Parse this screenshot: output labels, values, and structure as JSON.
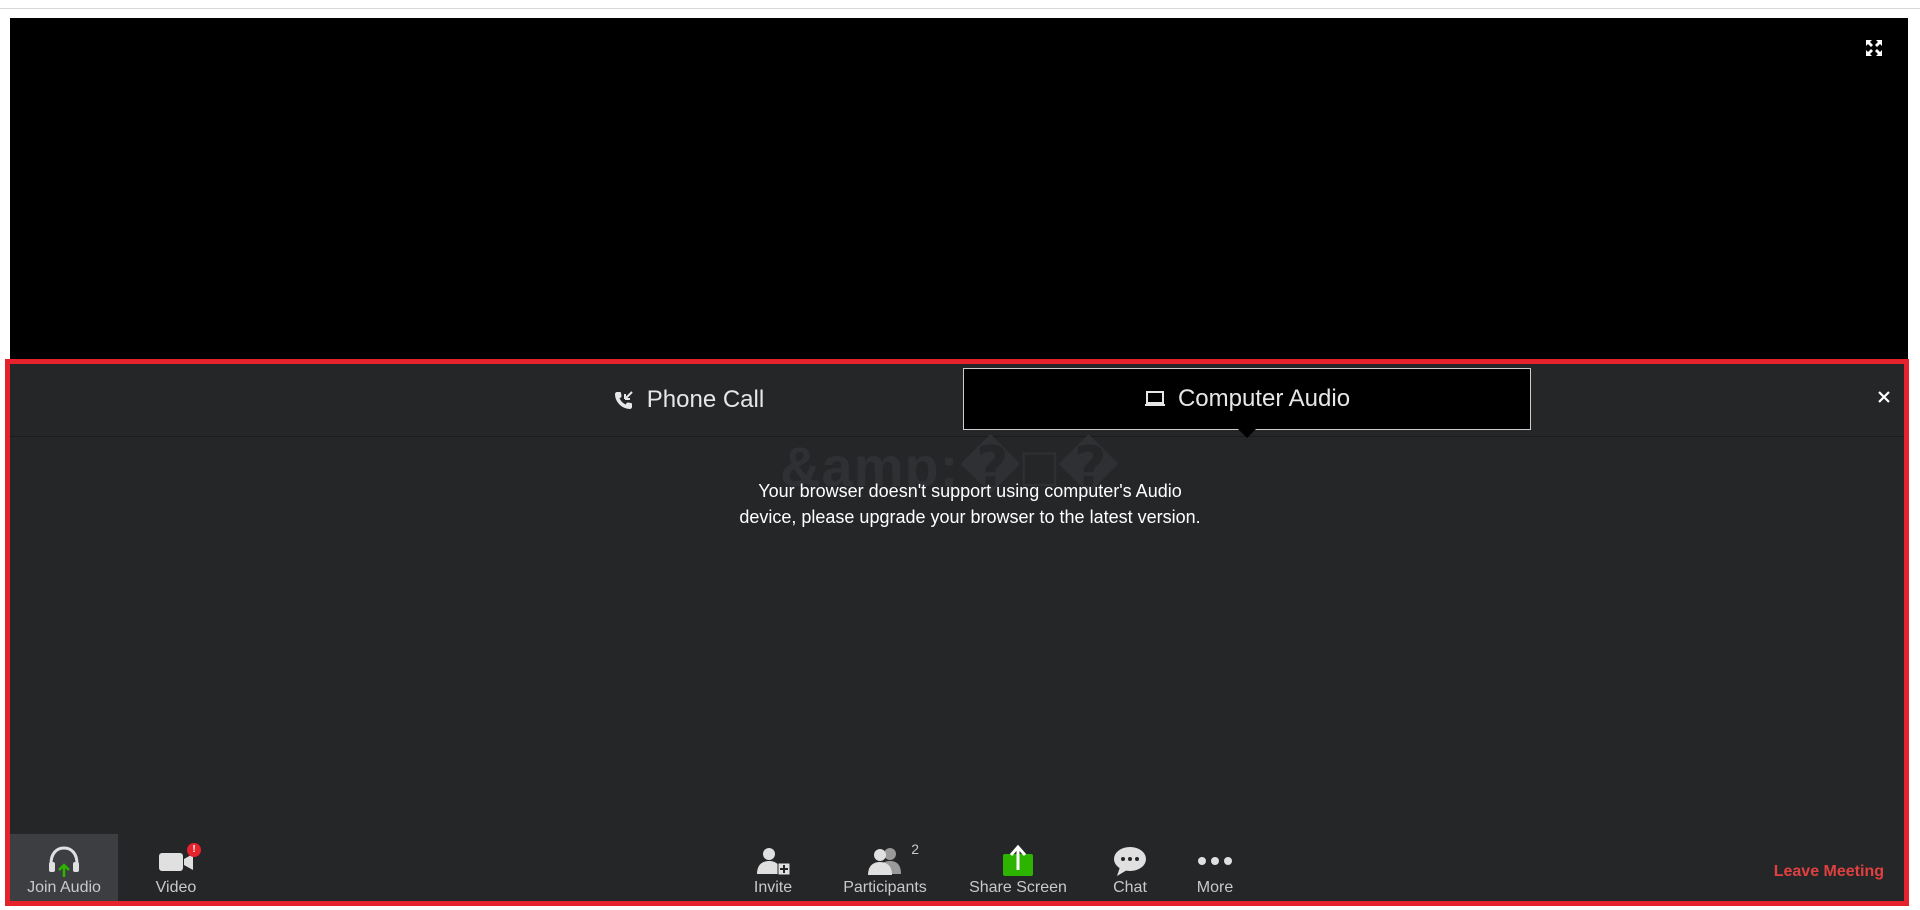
{
  "tabs": {
    "phone_call": "Phone Call",
    "computer_audio": "Computer Audio"
  },
  "garbled_text": "&amp;�□�",
  "message": {
    "line1": "Your browser doesn't support using computer's Audio",
    "line2": "device, please upgrade your browser to the latest version."
  },
  "toolbar": {
    "join_audio": "Join Audio",
    "video": "Video",
    "video_badge": "!",
    "invite": "Invite",
    "participants": "Participants",
    "participants_count": "2",
    "share_screen": "Share Screen",
    "chat": "Chat",
    "more": "More",
    "leave_meeting": "Leave Meeting"
  },
  "colors": {
    "frame_border": "#e6222c",
    "panel_bg": "#252628",
    "share_green": "#2db400",
    "leave_red": "#e0403f"
  }
}
